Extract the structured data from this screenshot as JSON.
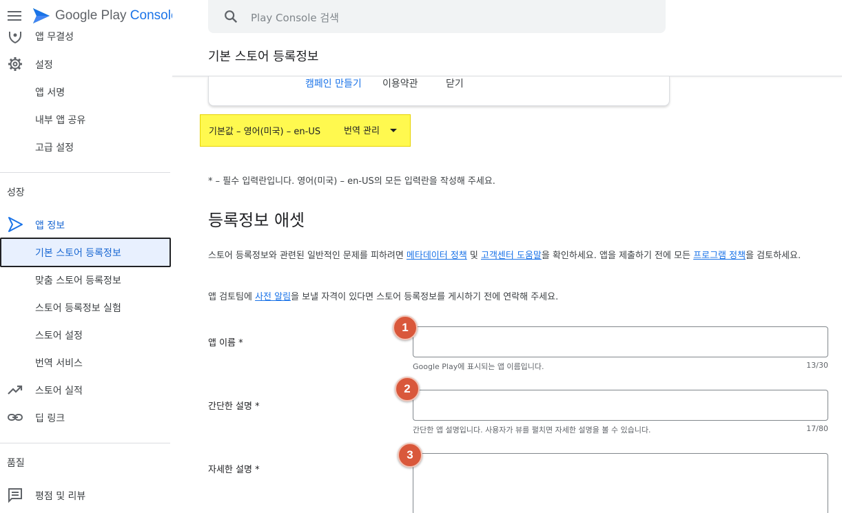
{
  "app": {
    "brand_name": "Google Play",
    "brand_accent": "Console",
    "brand_color": "#1a73e8"
  },
  "search": {
    "placeholder": "Play Console 검색"
  },
  "page": {
    "title": "기본 스토어 등록정보"
  },
  "sidebar": {
    "partial_item": "앱 무결성",
    "items_top": [
      {
        "label": "설정",
        "icon": "gear-icon"
      },
      {
        "label": "앱 서명"
      },
      {
        "label": "내부 앱 공유"
      },
      {
        "label": "고급 설정"
      }
    ],
    "section_growth": "성장",
    "app_info": {
      "label": "앱 정보",
      "icon": "play-outline-icon"
    },
    "items_growth": [
      {
        "label": "기본 스토어 등록정보",
        "active": true
      },
      {
        "label": "맞춤 스토어 등록정보"
      },
      {
        "label": "스토어 등록정보 실험"
      },
      {
        "label": "스토어 설정"
      },
      {
        "label": "번역 서비스"
      }
    ],
    "store_performance": {
      "label": "스토어 실적",
      "icon": "trending-up-icon"
    },
    "deep_links": {
      "label": "딥 링크",
      "icon": "link-icon"
    },
    "section_quality": "품질",
    "ratings": {
      "label": "평점 및 리뷰",
      "icon": "comment-icon"
    }
  },
  "card": {
    "create_campaign": "캠페인 만들기",
    "terms": "이용약관",
    "close": "닫기"
  },
  "language": {
    "default_text": "기본값 – 영어(미국) – en-US",
    "manage_translations": "번역 관리",
    "highlight_color": "#fff94f"
  },
  "main": {
    "required_note": "* – 필수 입력란입니다. 영어(미국) – en-US의 모든 입력란을 작성해 주세요.",
    "section_heading": "등록정보 애셋",
    "para1_before": "스토어 등록정보와 관련된 일반적인 문제를 피하려면 ",
    "para1_link1": "메타데이터 정책",
    "para1_mid1": " 및 ",
    "para1_link2": "고객센터 도움말",
    "para1_mid2": "을 확인하세요. 앱을 제출하기 전에 모든 ",
    "para1_link3": "프로그램 정책",
    "para1_after": "을 검토하세요.",
    "para2_before": "앱 검토팀에 ",
    "para2_link": "사전 알림",
    "para2_after": "을 보낼 자격이 있다면 스토어 등록정보를 게시하기 전에 연락해 주세요."
  },
  "fields": [
    {
      "label": "앱 이름  *",
      "value": "",
      "helper": "Google Play에 표시되는 앱 이름입니다.",
      "counter": "13/30",
      "badge": "1"
    },
    {
      "label": "간단한 설명  *",
      "value": "",
      "helper": "간단한 앱 설명입니다. 사용자가 뷰를 펼치면 자세한 설명을 볼 수 있습니다.",
      "counter": "17/80",
      "badge": "2"
    },
    {
      "label": "자세한 설명  *",
      "value": "",
      "badge": "3"
    }
  ],
  "badge_color": "#d9583b"
}
